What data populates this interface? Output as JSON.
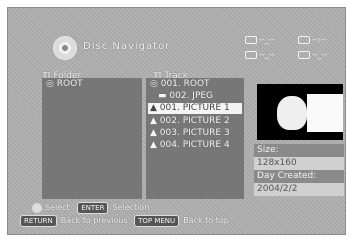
{
  "header": {
    "title": "Disc Navigator",
    "disc_icon": "disc-icon"
  },
  "indicators": [
    "--_--",
    "--:--",
    "--_--",
    "--_--"
  ],
  "folder_column": {
    "label": "Folder",
    "items": [
      "ROOT"
    ]
  },
  "track_column": {
    "label": "Track",
    "items": [
      "001. ROOT",
      "002. JPEG",
      "001. PICTURE 1",
      "002. PICTURE 2",
      "003. PICTURE 3",
      "004. PICTURE 4"
    ],
    "selected_index": 2
  },
  "info": {
    "size_label": "Size:",
    "size_value": "128x160",
    "date_label": "Day Created:",
    "date_value": "2004/2/2"
  },
  "footer": {
    "select_label": "Select",
    "enter_key": "ENTER",
    "enter_label": "Selection",
    "return_key": "RETURN",
    "return_label": "Back to previous",
    "topmenu_key": "TOP MENU",
    "topmenu_label": "Back to top"
  }
}
